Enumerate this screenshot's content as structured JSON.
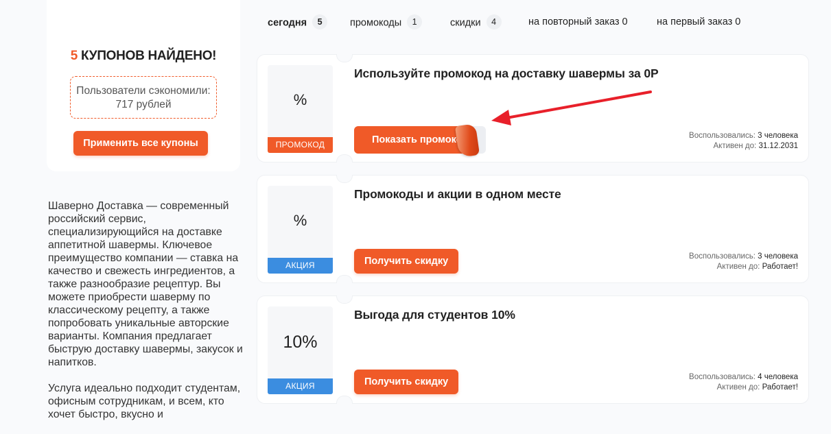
{
  "summary": {
    "found_count": "5",
    "found_text": " КУПОНОВ НАЙДЕНО!",
    "saved_text": "Пользователи сэкономили: 717 рублей",
    "apply_all_label": "Применить все купоны"
  },
  "about": {
    "paragraph1": "Шаверно Доставка — современный российский сервис, специализирующийся на доставке аппетитной шавермы. Ключевое преимущество компании — ставка на качество и свежесть ингредиентов, а также разнообразие рецептур. Вы можете приобрести шаверму по классическому рецепту, а также попробовать уникальные авторские варианты. Компания предлагает быструю доставку шавермы, закусок и напитков.",
    "paragraph2": "Услуга идеально подходит студентам, офисным сотрудникам, и всем, кто хочет быстро, вкусно и"
  },
  "filters": [
    {
      "label": "сегодня",
      "count": "5"
    },
    {
      "label": "промокоды",
      "count": "1"
    },
    {
      "label": "скидки",
      "count": "4"
    },
    {
      "label": "на повторный заказ 0"
    },
    {
      "label": "на первый заказ 0"
    }
  ],
  "coupons": [
    {
      "value": "%",
      "tag": "ПРОМОКОД",
      "title": "Используйте промокод на доставку шавермы за 0Р",
      "button": "Показать промокод",
      "used_label": "Воспользовались:",
      "used_value": "3 человека",
      "active_label": "Активен до:",
      "active_value": "31.12.2031"
    },
    {
      "value": "%",
      "tag": "АКЦИЯ",
      "title": "Промокоды и акции в одном месте",
      "button": "Получить скидку",
      "used_label": "Воспользовались:",
      "used_value": "3 человека",
      "active_label": "Активен до:",
      "active_value": "Работает!"
    },
    {
      "value": "10%",
      "tag": "АКЦИЯ",
      "title": "Выгода для студентов 10%",
      "button": "Получить скидку",
      "used_label": "Воспользовались:",
      "used_value": "4 человека",
      "active_label": "Активен до:",
      "active_value": "Работает!"
    }
  ],
  "colors": {
    "accent": "#f05a28",
    "promo_tag": "#f05a28",
    "action_tag": "#3b8de0",
    "arrow": "#e8202a"
  }
}
